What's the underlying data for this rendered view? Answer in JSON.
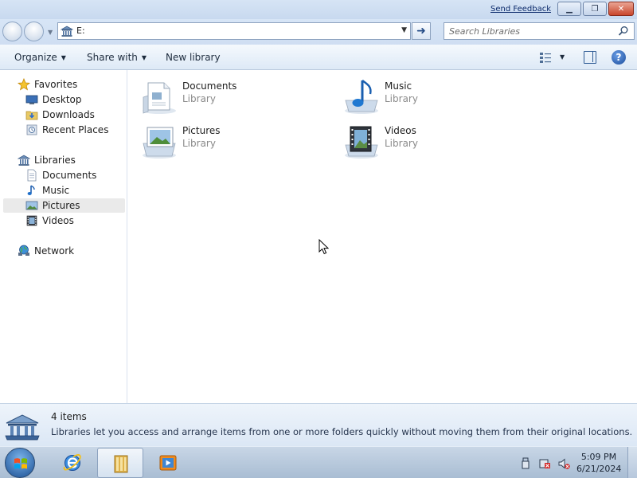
{
  "window": {
    "send_feedback": "Send Feedback",
    "buttons": [
      "minimize",
      "restore",
      "close"
    ]
  },
  "address_bar": {
    "path": "E:",
    "path_icon": "library-icon",
    "search_placeholder": "Search Libraries"
  },
  "toolbar": {
    "organize": "Organize",
    "share_with": "Share with",
    "new_library": "New library"
  },
  "navigation": {
    "favorites": {
      "label": "Favorites",
      "items": [
        "Desktop",
        "Downloads",
        "Recent Places"
      ]
    },
    "libraries": {
      "label": "Libraries",
      "items": [
        "Documents",
        "Music",
        "Pictures",
        "Videos"
      ],
      "selected": "Pictures"
    },
    "network": {
      "label": "Network"
    }
  },
  "content": {
    "libraries": [
      {
        "name": "Documents",
        "type": "Library",
        "icon": "documents-library-icon"
      },
      {
        "name": "Music",
        "type": "Library",
        "icon": "music-library-icon"
      },
      {
        "name": "Pictures",
        "type": "Library",
        "icon": "pictures-library-icon"
      },
      {
        "name": "Videos",
        "type": "Library",
        "icon": "videos-library-icon"
      }
    ]
  },
  "details": {
    "count": "4 items",
    "description": "Libraries let you access and arrange items from one or more folders quickly without moving them from their original locations."
  },
  "taskbar": {
    "apps": [
      "internet-explorer-icon",
      "windows-explorer-icon",
      "media-player-icon"
    ],
    "active_app": "windows-explorer-icon",
    "time": "5:09 PM",
    "date": "6/21/2024"
  },
  "colors": {
    "chrome": "#d7e5f6",
    "selection": "#eaeaea",
    "accent": "#1c4d9c"
  }
}
